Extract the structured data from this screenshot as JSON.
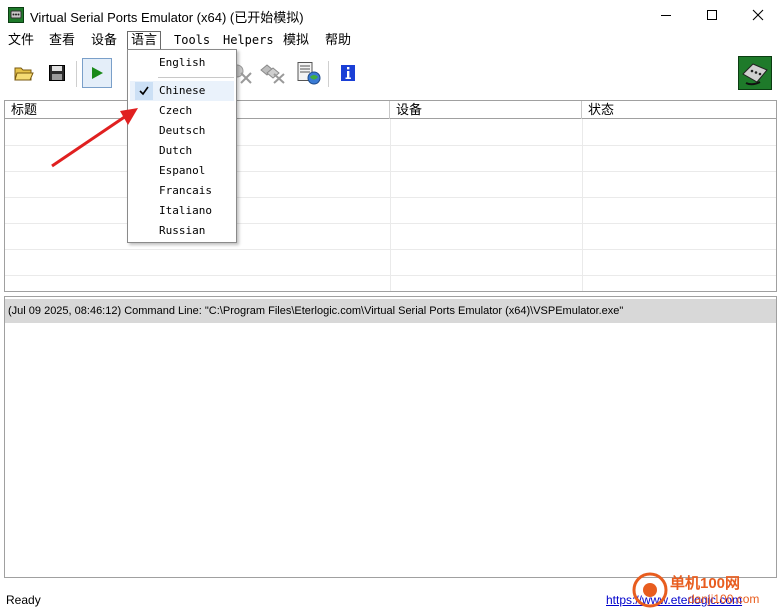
{
  "window": {
    "title": "Virtual Serial Ports Emulator (x64) (已开始模拟)",
    "icon": "serial-port-icon"
  },
  "menubar": {
    "items": [
      {
        "label": "文件"
      },
      {
        "label": "查看"
      },
      {
        "label": "设备"
      },
      {
        "label": "语言"
      },
      {
        "label": "Tools"
      },
      {
        "label": "Helpers"
      },
      {
        "label": "模拟"
      },
      {
        "label": "帮助"
      }
    ]
  },
  "language_menu": {
    "items": [
      {
        "label": "English",
        "checked": false
      },
      {
        "label": "Chinese",
        "checked": true
      },
      {
        "label": "Czech",
        "checked": false
      },
      {
        "label": "Deutsch",
        "checked": false
      },
      {
        "label": "Dutch",
        "checked": false
      },
      {
        "label": "Espanol",
        "checked": false
      },
      {
        "label": "Francais",
        "checked": false
      },
      {
        "label": "Italiano",
        "checked": false
      },
      {
        "label": "Russian",
        "checked": false
      }
    ]
  },
  "toolbar": {
    "icons": [
      "open-folder-icon",
      "save-icon",
      "play-icon",
      "delete-device-icon",
      "remove-device-icon",
      "device-settings-icon",
      "info-icon"
    ],
    "accent_play": "#1a8a1a",
    "accent_info": "#1a3fd6"
  },
  "grid": {
    "columns": [
      {
        "label": "标题"
      },
      {
        "label": "设备"
      },
      {
        "label": "状态"
      }
    ]
  },
  "log": {
    "lines": [
      "(Jul 09 2025, 08:46:12) Command Line: \"C:\\Program Files\\Eterlogic.com\\Virtual Serial Ports Emulator (x64)\\VSPEmulator.exe\""
    ]
  },
  "statusbar": {
    "text": "Ready",
    "link": "https://www.eterlogic.com"
  },
  "watermark": {
    "brand": "单机100网",
    "site": "danji100.com"
  }
}
